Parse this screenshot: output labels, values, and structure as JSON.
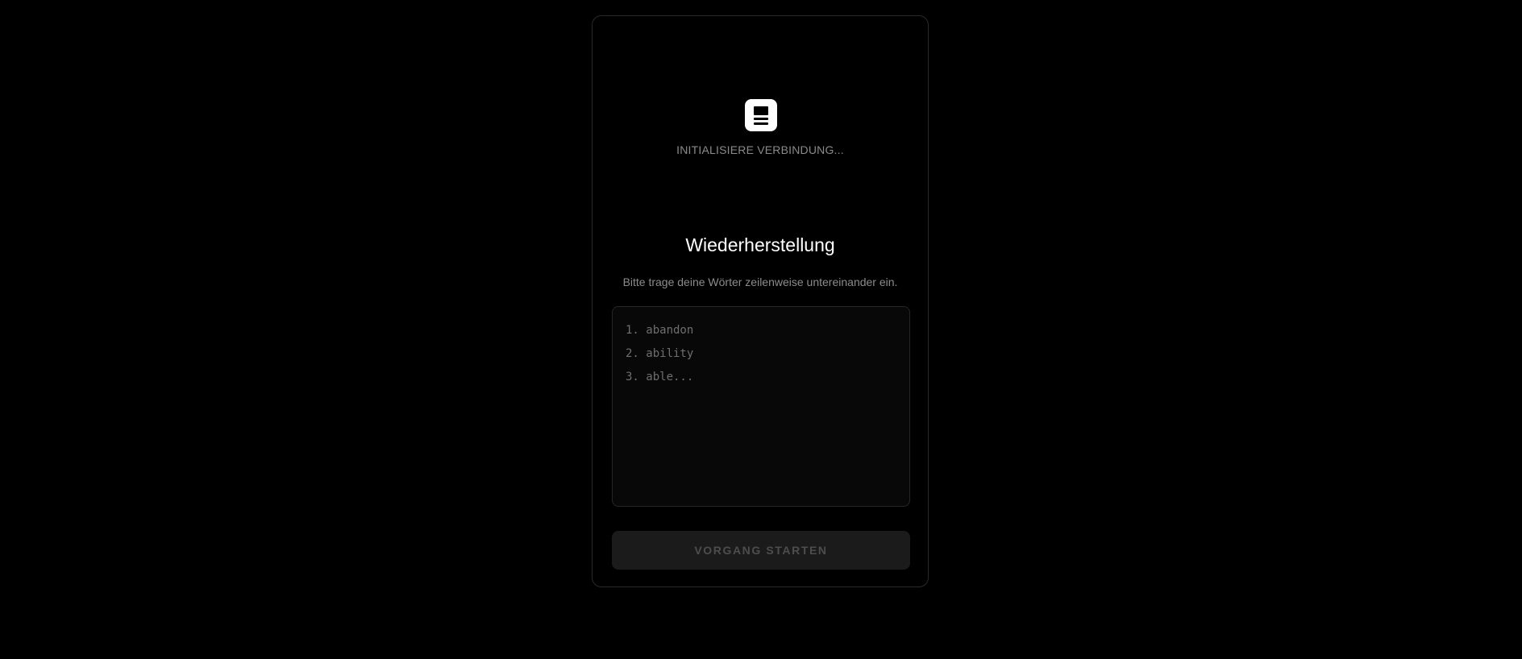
{
  "header": {
    "logo_icon": "server-stack-icon",
    "status_text": "INITIALISIERE VERBINDUNG..."
  },
  "recovery": {
    "title": "Wiederherstellung",
    "subtitle": "Bitte trage deine Wörter zeilenweise untereinander ein.",
    "input_value": "",
    "input_placeholder": "1. abandon\n2. ability\n3. able...",
    "start_button_label": "VORGANG STARTEN"
  },
  "colors": {
    "background": "#000000",
    "card_border": "#2a2a2a",
    "button_bg": "#1b1b1b",
    "button_text": "#4d4d4d"
  }
}
